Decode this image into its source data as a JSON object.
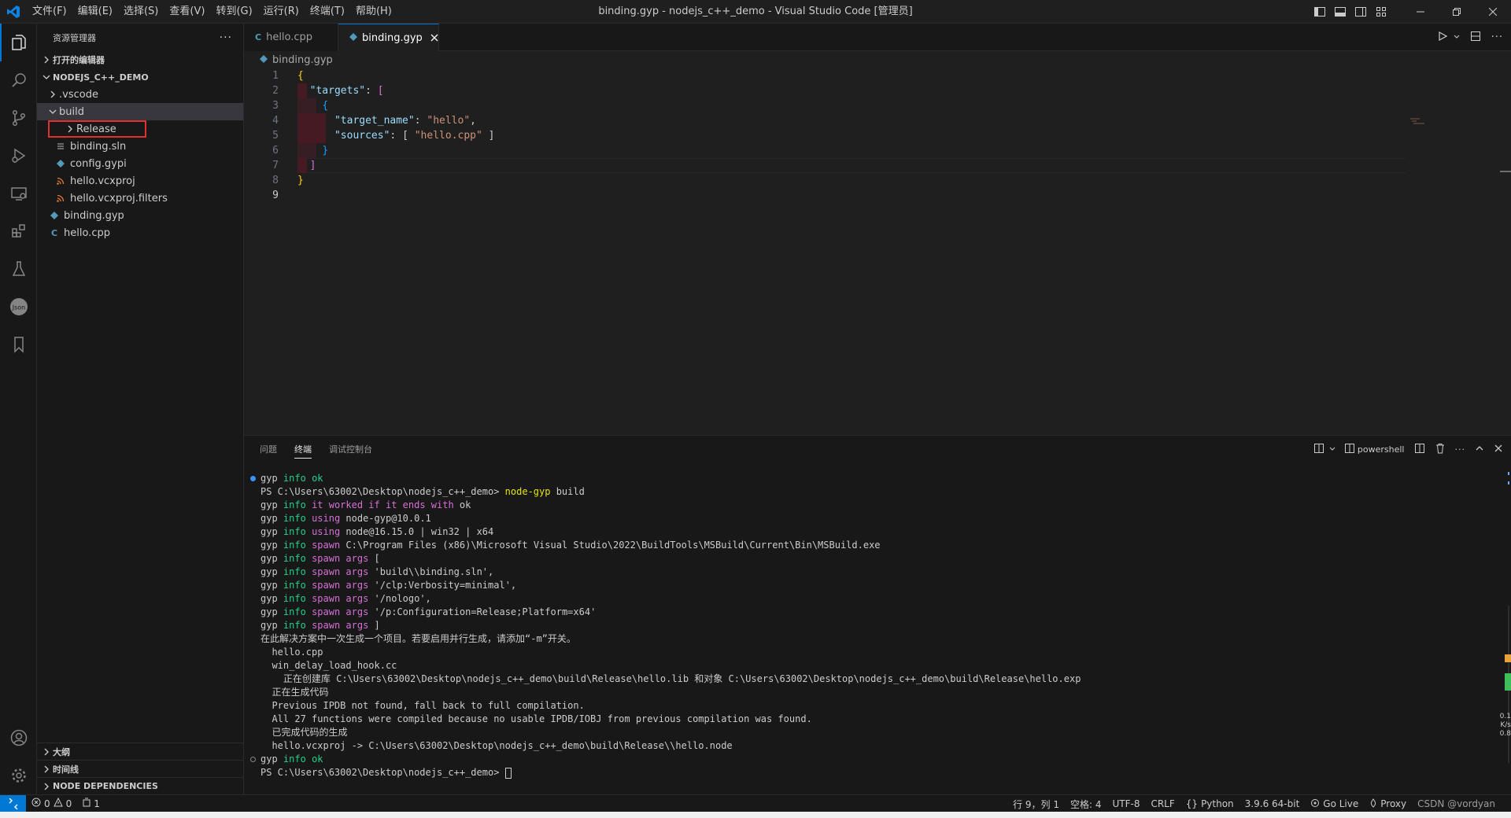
{
  "titlebar": {
    "menu": [
      "文件(F)",
      "编辑(E)",
      "选择(S)",
      "查看(V)",
      "转到(G)",
      "运行(R)",
      "终端(T)",
      "帮助(H)"
    ],
    "title": "binding.gyp - nodejs_c++_demo - Visual Studio Code [管理员]"
  },
  "sidebar": {
    "header": "资源管理器",
    "open_editors": "打开的编辑器",
    "workspace": "NODEJS_C++_DEMO",
    "tree": [
      {
        "label": ".vscode",
        "type": "folder",
        "depth": 1,
        "expanded": false
      },
      {
        "label": "build",
        "type": "folder",
        "depth": 1,
        "expanded": true
      },
      {
        "label": "Release",
        "type": "folder",
        "depth": 2,
        "expanded": false
      },
      {
        "label": "binding.sln",
        "type": "file",
        "depth": 2,
        "icon": "lines-file-icon"
      },
      {
        "label": "config.gypi",
        "type": "file",
        "depth": 2,
        "icon": "gyp-file-icon"
      },
      {
        "label": "hello.vcxproj",
        "type": "file",
        "depth": 2,
        "icon": "rss-file-icon"
      },
      {
        "label": "hello.vcxproj.filters",
        "type": "file",
        "depth": 2,
        "icon": "rss-file-icon"
      },
      {
        "label": "binding.gyp",
        "type": "file",
        "depth": 1,
        "icon": "gyp-file-icon"
      },
      {
        "label": "hello.cpp",
        "type": "file",
        "depth": 1,
        "icon": "cpp-file-icon"
      }
    ],
    "outline": "大纲",
    "timeline": "时间线",
    "node_deps": "NODE DEPENDENCIES"
  },
  "editor": {
    "tabs": [
      {
        "label": "hello.cpp",
        "icon": "cpp-file-icon",
        "active": false
      },
      {
        "label": "binding.gyp",
        "icon": "gyp-file-icon",
        "active": true
      }
    ],
    "breadcrumb": "binding.gyp",
    "lines": [
      {
        "n": "1",
        "t": [
          {
            "c": "p-gold",
            "v": "{"
          }
        ]
      },
      {
        "n": "2",
        "t": [
          {
            "c": "w",
            "v": "  "
          },
          {
            "c": "k",
            "v": "\"targets\""
          },
          {
            "c": "w",
            "v": ": "
          },
          {
            "c": "p-pink",
            "v": "["
          }
        ]
      },
      {
        "n": "3",
        "t": [
          {
            "c": "w",
            "v": "    "
          },
          {
            "c": "p-blue",
            "v": "{"
          }
        ]
      },
      {
        "n": "4",
        "t": [
          {
            "c": "w",
            "v": "      "
          },
          {
            "c": "k",
            "v": "\"target_name\""
          },
          {
            "c": "w",
            "v": ": "
          },
          {
            "c": "s",
            "v": "\"hello\""
          },
          {
            "c": "w",
            "v": ","
          }
        ]
      },
      {
        "n": "5",
        "t": [
          {
            "c": "w",
            "v": "      "
          },
          {
            "c": "k",
            "v": "\"sources\""
          },
          {
            "c": "w",
            "v": ": [ "
          },
          {
            "c": "s",
            "v": "\"hello.cpp\""
          },
          {
            "c": "w",
            "v": " ]"
          }
        ]
      },
      {
        "n": "6",
        "t": [
          {
            "c": "w",
            "v": "    "
          },
          {
            "c": "p-blue",
            "v": "}"
          }
        ]
      },
      {
        "n": "7",
        "t": [
          {
            "c": "w",
            "v": "  "
          },
          {
            "c": "p-pink",
            "v": "]"
          }
        ]
      },
      {
        "n": "8",
        "t": [
          {
            "c": "p-gold",
            "v": "}"
          }
        ]
      },
      {
        "n": "9",
        "t": []
      }
    ]
  },
  "panel": {
    "tabs": [
      "问题",
      "终端",
      "调试控制台"
    ],
    "active_tab": "终端",
    "shell": "powershell",
    "terminal": [
      {
        "dot": "blue",
        "segs": [
          [
            "t-gyp",
            "gyp"
          ],
          [
            "w",
            " "
          ],
          [
            "t-info",
            "info"
          ],
          [
            "w",
            " "
          ],
          [
            "t-info",
            "ok"
          ]
        ]
      },
      {
        "segs": [
          [
            "w",
            "PS C:\\Users\\63002\\Desktop\\nodejs_c++_demo> "
          ],
          [
            "t-yel",
            "node-gyp"
          ],
          [
            "w",
            " build"
          ]
        ]
      },
      {
        "segs": [
          [
            "t-gyp",
            "gyp"
          ],
          [
            "w",
            " "
          ],
          [
            "t-info",
            "info"
          ],
          [
            "w",
            " "
          ],
          [
            "t-mag",
            "it worked if it ends with"
          ],
          [
            "w",
            " ok"
          ]
        ]
      },
      {
        "segs": [
          [
            "t-gyp",
            "gyp"
          ],
          [
            "w",
            " "
          ],
          [
            "t-info",
            "info"
          ],
          [
            "w",
            " "
          ],
          [
            "t-mag",
            "using"
          ],
          [
            "w",
            " node-gyp@10.0.1"
          ]
        ]
      },
      {
        "segs": [
          [
            "t-gyp",
            "gyp"
          ],
          [
            "w",
            " "
          ],
          [
            "t-info",
            "info"
          ],
          [
            "w",
            " "
          ],
          [
            "t-mag",
            "using"
          ],
          [
            "w",
            " node@16.15.0 | win32 | x64"
          ]
        ]
      },
      {
        "segs": [
          [
            "t-gyp",
            "gyp"
          ],
          [
            "w",
            " "
          ],
          [
            "t-info",
            "info"
          ],
          [
            "w",
            " "
          ],
          [
            "t-mag",
            "spawn"
          ],
          [
            "w",
            " C:\\Program Files (x86)\\Microsoft Visual Studio\\2022\\BuildTools\\MSBuild\\Current\\Bin\\MSBuild.exe"
          ]
        ]
      },
      {
        "segs": [
          [
            "t-gyp",
            "gyp"
          ],
          [
            "w",
            " "
          ],
          [
            "t-info",
            "info"
          ],
          [
            "w",
            " "
          ],
          [
            "t-mag",
            "spawn args"
          ],
          [
            "w",
            " ["
          ]
        ]
      },
      {
        "segs": [
          [
            "t-gyp",
            "gyp"
          ],
          [
            "w",
            " "
          ],
          [
            "t-info",
            "info"
          ],
          [
            "w",
            " "
          ],
          [
            "t-mag",
            "spawn args"
          ],
          [
            "w",
            " 'build\\\\binding.sln',"
          ]
        ]
      },
      {
        "segs": [
          [
            "t-gyp",
            "gyp"
          ],
          [
            "w",
            " "
          ],
          [
            "t-info",
            "info"
          ],
          [
            "w",
            " "
          ],
          [
            "t-mag",
            "spawn args"
          ],
          [
            "w",
            " '/clp:Verbosity=minimal',"
          ]
        ]
      },
      {
        "segs": [
          [
            "t-gyp",
            "gyp"
          ],
          [
            "w",
            " "
          ],
          [
            "t-info",
            "info"
          ],
          [
            "w",
            " "
          ],
          [
            "t-mag",
            "spawn args"
          ],
          [
            "w",
            " '/nologo',"
          ]
        ]
      },
      {
        "segs": [
          [
            "t-gyp",
            "gyp"
          ],
          [
            "w",
            " "
          ],
          [
            "t-info",
            "info"
          ],
          [
            "w",
            " "
          ],
          [
            "t-mag",
            "spawn args"
          ],
          [
            "w",
            " '/p:Configuration=Release;Platform=x64'"
          ]
        ]
      },
      {
        "segs": [
          [
            "t-gyp",
            "gyp"
          ],
          [
            "w",
            " "
          ],
          [
            "t-info",
            "info"
          ],
          [
            "w",
            " "
          ],
          [
            "t-mag",
            "spawn args"
          ],
          [
            "w",
            " ]"
          ]
        ]
      },
      {
        "segs": [
          [
            "w",
            "在此解决方案中一次生成一个项目。若要启用并行生成，请添加“-m”开关。"
          ]
        ]
      },
      {
        "segs": [
          [
            "w",
            "  hello.cpp"
          ]
        ]
      },
      {
        "segs": [
          [
            "w",
            "  win_delay_load_hook.cc"
          ]
        ]
      },
      {
        "segs": [
          [
            "w",
            "    正在创建库 C:\\Users\\63002\\Desktop\\nodejs_c++_demo\\build\\Release\\hello.lib 和对象 C:\\Users\\63002\\Desktop\\nodejs_c++_demo\\build\\Release\\hello.exp"
          ]
        ]
      },
      {
        "segs": [
          [
            "w",
            "  正在生成代码"
          ]
        ]
      },
      {
        "segs": [
          [
            "w",
            "  Previous IPDB not found, fall back to full compilation."
          ]
        ]
      },
      {
        "segs": [
          [
            "w",
            "  All 27 functions were compiled because no usable IPDB/IOBJ from previous compilation was found."
          ]
        ]
      },
      {
        "segs": [
          [
            "w",
            "  已完成代码的生成"
          ]
        ]
      },
      {
        "segs": [
          [
            "w",
            "  hello.vcxproj -> C:\\Users\\63002\\Desktop\\nodejs_c++_demo\\build\\Release\\\\hello.node"
          ]
        ]
      },
      {
        "dot": "hollow",
        "segs": [
          [
            "t-gyp",
            "gyp"
          ],
          [
            "w",
            " "
          ],
          [
            "t-info",
            "info"
          ],
          [
            "w",
            " "
          ],
          [
            "t-info",
            "ok"
          ]
        ]
      },
      {
        "cursor": true,
        "segs": [
          [
            "w",
            "PS C:\\Users\\63002\\Desktop\\nodejs_c++_demo> "
          ]
        ]
      }
    ],
    "side_readout": [
      "0.1",
      "K/s",
      "0.8"
    ]
  },
  "statusbar": {
    "errors": "0",
    "warnings": "0",
    "ports": "1",
    "position": "行 9，列 1",
    "spaces": "空格: 4",
    "encoding": "UTF-8",
    "eol": "CRLF",
    "language": "Python",
    "interpreter": "3.9.6 64-bit",
    "golive": "Go Live",
    "proxy": "Proxy",
    "watermark": "CSDN @vordyan"
  },
  "colors": {
    "accent": "#0078d4",
    "highlight_box": "#e03030"
  }
}
